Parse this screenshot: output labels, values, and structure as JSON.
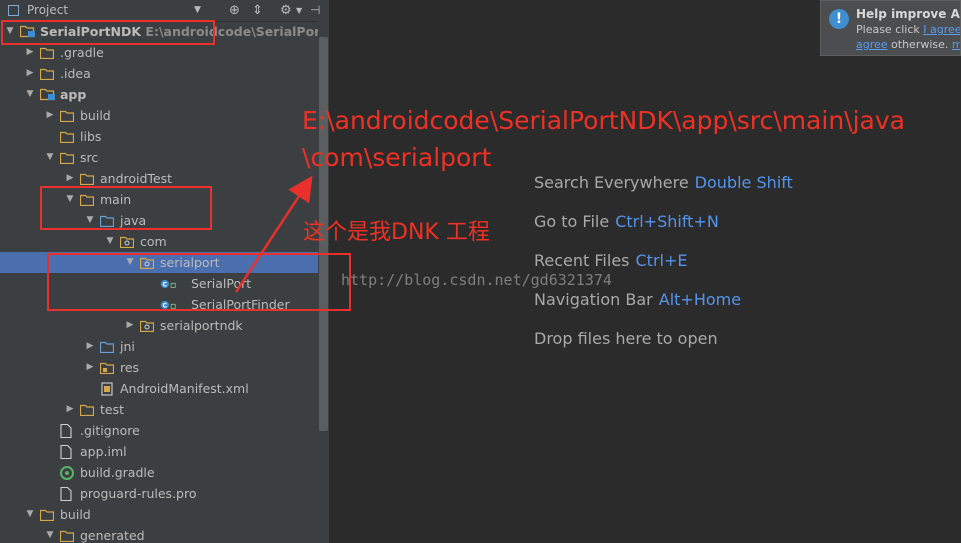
{
  "panel_header": {
    "title": "Project",
    "icons": [
      "globe-target-icon",
      "collapse-icon",
      "gear-icon",
      "hide-icon"
    ]
  },
  "tree": [
    {
      "label": "SerialPortNDK",
      "path": "E:\\androidcode\\SerialPortNDK",
      "depth": 0,
      "expanded": true,
      "icon": "module",
      "bold": true
    },
    {
      "label": ".gradle",
      "depth": 1,
      "expanded": false,
      "icon": "folder"
    },
    {
      "label": ".idea",
      "depth": 1,
      "expanded": false,
      "icon": "folder"
    },
    {
      "label": "app",
      "depth": 1,
      "expanded": true,
      "icon": "module",
      "bold": true
    },
    {
      "label": "build",
      "depth": 2,
      "expanded": false,
      "icon": "folder"
    },
    {
      "label": "libs",
      "depth": 2,
      "icon": "folder"
    },
    {
      "label": "src",
      "depth": 2,
      "expanded": true,
      "icon": "folder"
    },
    {
      "label": "androidTest",
      "depth": 3,
      "expanded": false,
      "icon": "folder"
    },
    {
      "label": "main",
      "depth": 3,
      "expanded": true,
      "icon": "folder"
    },
    {
      "label": "java",
      "depth": 4,
      "expanded": true,
      "icon": "source-folder"
    },
    {
      "label": "com",
      "depth": 5,
      "expanded": true,
      "icon": "package"
    },
    {
      "label": "serialport",
      "depth": 6,
      "expanded": true,
      "icon": "package",
      "selected": true
    },
    {
      "label": "SerialPort",
      "depth": 7,
      "icon": "class"
    },
    {
      "label": "SerialPortFinder",
      "depth": 7,
      "icon": "class"
    },
    {
      "label": "serialportndk",
      "depth": 6,
      "expanded": false,
      "icon": "package"
    },
    {
      "label": "jni",
      "depth": 4,
      "expanded": false,
      "icon": "source-folder"
    },
    {
      "label": "res",
      "depth": 4,
      "expanded": false,
      "icon": "res-folder"
    },
    {
      "label": "AndroidManifest.xml",
      "depth": 4,
      "icon": "manifest"
    },
    {
      "label": "test",
      "depth": 3,
      "expanded": false,
      "icon": "folder"
    },
    {
      "label": ".gitignore",
      "depth": 2,
      "icon": "file"
    },
    {
      "label": "app.iml",
      "depth": 2,
      "icon": "file"
    },
    {
      "label": "build.gradle",
      "depth": 2,
      "icon": "gradle"
    },
    {
      "label": "proguard-rules.pro",
      "depth": 2,
      "icon": "file"
    },
    {
      "label": "build",
      "depth": 1,
      "expanded": true,
      "icon": "folder"
    },
    {
      "label": "generated",
      "depth": 2,
      "expanded": true,
      "icon": "folder"
    }
  ],
  "editor_hints": [
    {
      "text": "Search Everywhere",
      "shortcut": "Double Shift"
    },
    {
      "text": "Go to File",
      "shortcut": "Ctrl+Shift+N"
    },
    {
      "text": "Recent Files",
      "shortcut": "Ctrl+E"
    },
    {
      "text": "Navigation Bar",
      "shortcut": "Alt+Home"
    },
    {
      "text": "Drop files here to open",
      "shortcut": ""
    }
  ],
  "notification": {
    "title": "Help improve And",
    "line1_prefix": "Please click",
    "line1_link": "I agree",
    "line2_link": "agree",
    "line2_suffix": "otherwise.",
    "line2_tail": "m"
  },
  "annotations": {
    "path_line1": "E:\\androidcode\\SerialPortNDK\\app\\src\\main\\java",
    "path_line2": "\\com\\serialport",
    "project_note": "这个是我DNK 工程",
    "annotation_color": "#ee3124"
  },
  "watermark": "http://blog.csdn.net/gd6321374",
  "colors": {
    "panel_bg": "#3c3f41",
    "editor_bg": "#2b2b2b",
    "selection": "#4b6eaf",
    "shortcut": "#5394ec",
    "folder": "#d6a84a"
  }
}
